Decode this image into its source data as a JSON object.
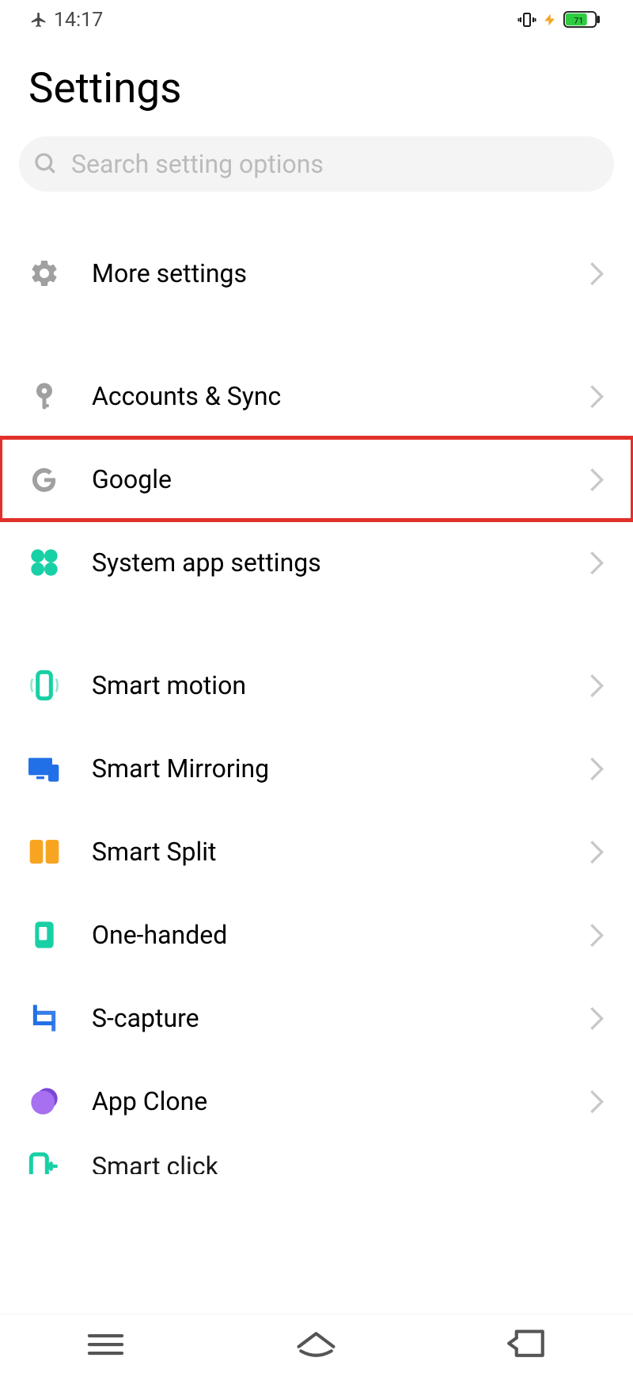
{
  "status_bar": {
    "time": "14:17",
    "battery_percent": 71
  },
  "header": {
    "title": "Settings"
  },
  "search": {
    "placeholder": "Search setting options"
  },
  "settings": {
    "items": [
      {
        "icon": "gear",
        "label": "More settings",
        "highlighted": false
      },
      {
        "icon": "key",
        "label": "Accounts & Sync",
        "highlighted": false
      },
      {
        "icon": "google",
        "label": "Google",
        "highlighted": true
      },
      {
        "icon": "grid-apps",
        "label": "System app settings",
        "highlighted": false
      },
      {
        "icon": "phone-motion",
        "label": "Smart motion",
        "highlighted": false
      },
      {
        "icon": "mirroring",
        "label": "Smart Mirroring",
        "highlighted": false
      },
      {
        "icon": "split",
        "label": "Smart Split",
        "highlighted": false
      },
      {
        "icon": "one-handed",
        "label": "One-handed",
        "highlighted": false
      },
      {
        "icon": "capture",
        "label": "S-capture",
        "highlighted": false
      },
      {
        "icon": "clone",
        "label": "App Clone",
        "highlighted": false
      }
    ],
    "truncated_item": {
      "label": "Smart click"
    }
  },
  "colors": {
    "teal": "#18d0a5",
    "blue": "#2270e8",
    "orange": "#f7a521",
    "purple": "#a670f0",
    "highlight_red": "#e2302a",
    "gray_icon": "#a0a0a0"
  }
}
